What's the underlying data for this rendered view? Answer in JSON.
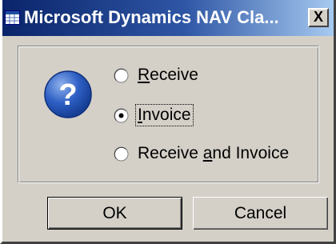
{
  "window": {
    "title": "Microsoft Dynamics NAV Cla...",
    "close_label": "X"
  },
  "dialog": {
    "options": [
      {
        "label_prefix": "",
        "label_mnemonic": "R",
        "label_suffix": "eceive",
        "selected": false
      },
      {
        "label_prefix": "",
        "label_mnemonic": "I",
        "label_suffix": "nvoice",
        "selected": true
      },
      {
        "label_prefix": "Receive ",
        "label_mnemonic": "a",
        "label_suffix": "nd Invoice",
        "selected": false
      }
    ],
    "icon": "question-icon"
  },
  "buttons": {
    "ok_label": "OK",
    "cancel_label": "Cancel"
  },
  "colors": {
    "titlebar_start": "#0a246a",
    "titlebar_end": "#a6caf0",
    "face": "#d4d0c8"
  }
}
